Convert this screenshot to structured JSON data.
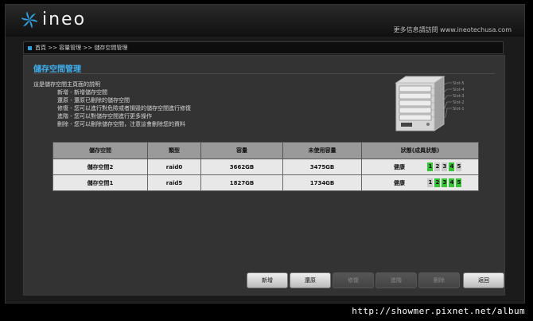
{
  "header": {
    "logo_text": "ineo",
    "promo": "更多信息請訪問 www.ineotechusa.com"
  },
  "breadcrumb": "首頁 >> 容量管理 >> 儲存空間管理",
  "page": {
    "title": "儲存空間管理",
    "description": {
      "intro": "這是儲存空間主頁面的説明",
      "lines": [
        "新增 - 新增儲存空間",
        "還原 - 還原已刪除的儲存空間",
        "修復 - 您可以進行對危險或者損毀的儲存空間進行修復",
        "進階 - 您可以對儲存空間進行更多操作",
        "刪除 - 您可以刪除儲存空間，注意這會刪除您的資料"
      ]
    }
  },
  "chassis": {
    "slots": [
      "Slot-5",
      "Slot-4",
      "Slot-3",
      "Slot-2",
      "Slot-1"
    ]
  },
  "table": {
    "columns": [
      "儲存空間",
      "類型",
      "容量",
      "未使用容量",
      "狀態(成員狀態)"
    ],
    "rows": [
      {
        "name": "儲存空間2",
        "type": "raid0",
        "capacity": "3662GB",
        "free": "3475GB",
        "status": "健康",
        "disks": [
          {
            "n": "1",
            "on": true
          },
          {
            "n": "2",
            "on": false
          },
          {
            "n": "3",
            "on": false
          },
          {
            "n": "4",
            "on": true
          },
          {
            "n": "5",
            "on": false
          }
        ]
      },
      {
        "name": "儲存空間1",
        "type": "raid5",
        "capacity": "1827GB",
        "free": "1734GB",
        "status": "健康",
        "disks": [
          {
            "n": "1",
            "on": false
          },
          {
            "n": "2",
            "on": true
          },
          {
            "n": "3",
            "on": true
          },
          {
            "n": "4",
            "on": true
          },
          {
            "n": "5",
            "on": true
          }
        ]
      }
    ]
  },
  "buttons": {
    "add": "新增",
    "restore": "還原",
    "repair": "修復",
    "advanced": "進階",
    "delete": "刪除",
    "back": "返回"
  },
  "colors": {
    "accent": "#3fb0f0",
    "disk_active": "#38c238",
    "disk_inactive": "#c9c9c9"
  },
  "watermark": "http://showmer.pixnet.net/album"
}
